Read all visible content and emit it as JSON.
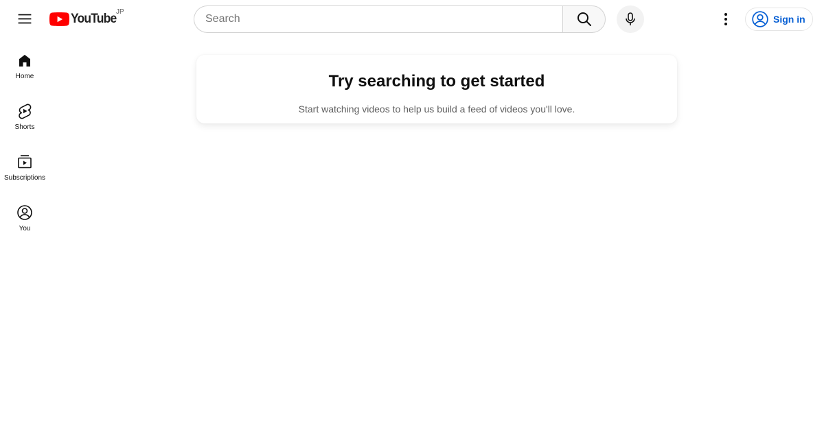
{
  "header": {
    "logo_text": "YouTube",
    "region_code": "JP",
    "search_placeholder": "Search",
    "signin_label": "Sign in"
  },
  "sidebar": {
    "items": [
      {
        "label": "Home",
        "icon": "home-icon"
      },
      {
        "label": "Shorts",
        "icon": "shorts-icon"
      },
      {
        "label": "Subscriptions",
        "icon": "subscriptions-icon"
      },
      {
        "label": "You",
        "icon": "account-icon"
      }
    ]
  },
  "main": {
    "title": "Try searching to get started",
    "subtitle": "Start watching videos to help us build a feed of videos you'll love."
  },
  "colors": {
    "brand_red": "#ff0000",
    "link_blue": "#065fd4",
    "text": "#0f0f0f",
    "secondary_text": "#606060"
  }
}
